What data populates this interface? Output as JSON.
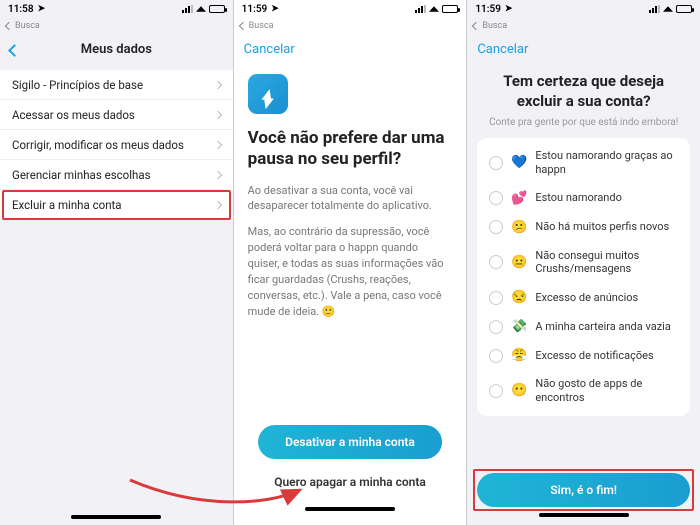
{
  "status": {
    "t1": "11:58",
    "t2": "11:59",
    "t3": "11:59",
    "back_search": "Busca"
  },
  "colors": {
    "accent": "#1aa0e6",
    "button_grad_a": "#1fb5d6",
    "button_grad_b": "#1a9ed0",
    "annotation_red": "#d93b3b"
  },
  "screen1": {
    "title": "Meus dados",
    "items": [
      "Sigilo - Princípios de base",
      "Acessar os meus dados",
      "Corrigir, modificar os meus dados",
      "Gerenciar minhas escolhas",
      "Excluir a minha conta"
    ]
  },
  "screen2": {
    "cancel": "Cancelar",
    "heading": "Você não prefere dar uma pausa no seu perfil?",
    "p1": "Ao desativar a sua conta, você vai desaparecer totalmente do aplicativo.",
    "p2": "Mas, ao contrário da supressão, você poderá voltar para o happn quando quiser, e todas as suas informações vão ficar guardadas (Crushs, reações, conversas, etc.). Vale a pena, caso você mude de ideia. 🙂",
    "primary_btn": "Desativar a minha conta",
    "secondary_btn": "Quero apagar a minha conta"
  },
  "screen3": {
    "cancel": "Cancelar",
    "heading": "Tem certeza que deseja excluir a sua conta?",
    "sub": "Conte pra gente por que está indo embora!",
    "options": [
      {
        "emoji": "💙",
        "label": "Estou namorando graças ao happn"
      },
      {
        "emoji": "💕",
        "label": "Estou namorando"
      },
      {
        "emoji": "😕",
        "label": "Não há muitos perfis novos"
      },
      {
        "emoji": "😐",
        "label": "Não consegui muitos Crushs/mensagens"
      },
      {
        "emoji": "😒",
        "label": "Excesso de anúncios"
      },
      {
        "emoji": "💸",
        "label": "A minha carteira anda vazia"
      },
      {
        "emoji": "😤",
        "label": "Excesso de notificações"
      },
      {
        "emoji": "😶",
        "label": "Não gosto de apps de encontros"
      }
    ],
    "confirm_btn": "Sim, é o fim!"
  }
}
